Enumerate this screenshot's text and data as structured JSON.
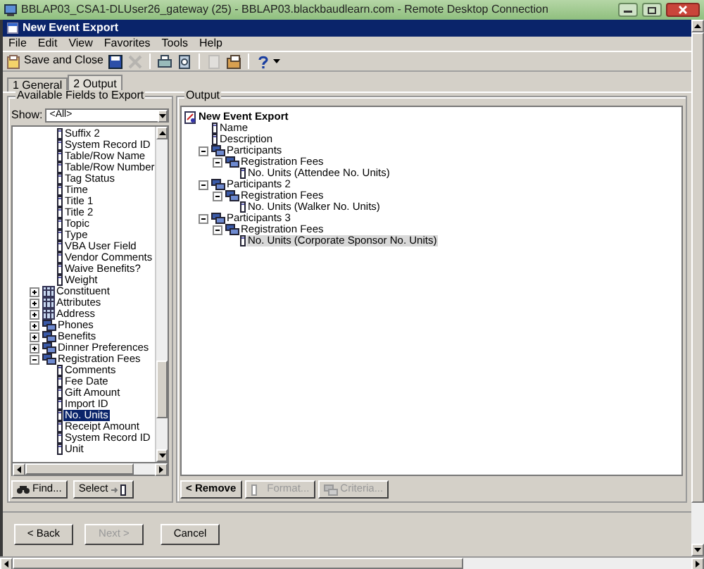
{
  "rdp_window": {
    "title": "BBLAP03_CSA1-DLUser26_gateway (25) - BBLAP03.blackbaudlearn.com - Remote Desktop Connection"
  },
  "app_window": {
    "title": "New Event Export"
  },
  "menu": [
    "File",
    "Edit",
    "View",
    "Favorites",
    "Tools",
    "Help"
  ],
  "toolbar": [
    {
      "kind": "save-close",
      "label": "Save and Close",
      "disabled": false
    },
    {
      "kind": "save",
      "disabled": false
    },
    {
      "kind": "delete",
      "disabled": true
    },
    {
      "kind": "separator"
    },
    {
      "kind": "print",
      "disabled": false
    },
    {
      "kind": "preview",
      "disabled": false
    },
    {
      "kind": "separator"
    },
    {
      "kind": "page",
      "disabled": true
    },
    {
      "kind": "properties",
      "disabled": false
    },
    {
      "kind": "separator"
    },
    {
      "kind": "help",
      "disabled": false
    }
  ],
  "tabs": [
    {
      "label": "1 General",
      "selected": false
    },
    {
      "label": "2 Output",
      "selected": true
    }
  ],
  "fields_panel": {
    "title": "Available Fields to Export",
    "show_label": "Show:",
    "show_value": "<All>",
    "continued_items": [
      {
        "label": "Suffix 2",
        "kind": "field",
        "selected": false
      },
      {
        "label": "System Record ID",
        "kind": "field",
        "selected": false
      },
      {
        "label": "Table/Row Name",
        "kind": "field",
        "selected": false
      },
      {
        "label": "Table/Row Number",
        "kind": "field",
        "selected": false
      },
      {
        "label": "Tag Status",
        "kind": "field",
        "selected": false
      },
      {
        "label": "Time",
        "kind": "field",
        "selected": false
      },
      {
        "label": "Title 1",
        "kind": "field",
        "selected": false
      },
      {
        "label": "Title 2",
        "kind": "field",
        "selected": false
      },
      {
        "label": "Topic",
        "kind": "field",
        "selected": false
      },
      {
        "label": "Type",
        "kind": "field",
        "selected": false
      },
      {
        "label": "VBA User Field",
        "kind": "field",
        "selected": false
      },
      {
        "label": "Vendor Comments",
        "kind": "field",
        "selected": false
      },
      {
        "label": "Waive Benefits?",
        "kind": "field",
        "selected": false
      },
      {
        "label": "Weight",
        "kind": "field",
        "selected": false
      }
    ],
    "items": [
      {
        "label": "Constituent",
        "kind": "table",
        "expanded": false,
        "selected": false
      },
      {
        "label": "Attributes",
        "kind": "table",
        "expanded": false,
        "selected": false
      },
      {
        "label": "Address",
        "kind": "table",
        "expanded": false,
        "selected": false
      },
      {
        "label": "Phones",
        "kind": "group",
        "expanded": false,
        "selected": false
      },
      {
        "label": "Benefits",
        "kind": "group",
        "expanded": false,
        "selected": false
      },
      {
        "label": "Dinner Preferences",
        "kind": "group",
        "expanded": false,
        "selected": false
      },
      {
        "label": "Registration Fees",
        "kind": "group",
        "expanded": true,
        "selected": false,
        "children": [
          {
            "label": "Comments",
            "kind": "field",
            "selected": false
          },
          {
            "label": "Fee Date",
            "kind": "field",
            "selected": false
          },
          {
            "label": "Gift Amount",
            "kind": "field",
            "selected": false
          },
          {
            "label": "Import ID",
            "kind": "field",
            "selected": false
          },
          {
            "label": "No. Units",
            "kind": "field",
            "selected": true
          },
          {
            "label": "Receipt Amount",
            "kind": "field",
            "selected": false
          },
          {
            "label": "System Record ID",
            "kind": "field",
            "selected": false
          },
          {
            "label": "Unit",
            "kind": "field",
            "selected": false
          }
        ]
      }
    ],
    "buttons": [
      {
        "kind": "find",
        "label": "Find...",
        "disabled": false
      },
      {
        "kind": "select",
        "label": "Select",
        "disabled": false
      }
    ]
  },
  "output_panel": {
    "title": "Output",
    "tree": [
      {
        "label": "New Event Export",
        "kind": "root",
        "selected": false,
        "children": [
          {
            "label": "Name",
            "kind": "field",
            "selected": false
          },
          {
            "label": "Description",
            "kind": "field",
            "selected": false
          },
          {
            "label": "Participants",
            "kind": "group",
            "expanded": true,
            "selected": false,
            "children": [
              {
                "label": "Registration Fees",
                "kind": "group",
                "expanded": true,
                "selected": false,
                "children": [
                  {
                    "label": "No. Units (Attendee No. Units)",
                    "kind": "field",
                    "selected": false
                  }
                ]
              }
            ]
          },
          {
            "label": "Participants 2",
            "kind": "group",
            "expanded": true,
            "selected": false,
            "children": [
              {
                "label": "Registration Fees",
                "kind": "group",
                "expanded": true,
                "selected": false,
                "children": [
                  {
                    "label": "No. Units (Walker No. Units)",
                    "kind": "field",
                    "selected": false
                  }
                ]
              }
            ]
          },
          {
            "label": "Participants 3",
            "kind": "group",
            "expanded": true,
            "selected": false,
            "children": [
              {
                "label": "Registration Fees",
                "kind": "group",
                "expanded": true,
                "selected": false,
                "children": [
                  {
                    "label": "No. Units (Corporate Sponsor No. Units)",
                    "kind": "field",
                    "selected": true
                  }
                ]
              }
            ]
          }
        ]
      }
    ],
    "buttons": [
      {
        "kind": "remove",
        "label": "< Remove",
        "disabled": false
      },
      {
        "kind": "format",
        "label": "Format...",
        "disabled": true
      },
      {
        "kind": "criteria",
        "label": "Criteria...",
        "disabled": true
      }
    ]
  },
  "wizard_buttons": [
    {
      "label": "< Back",
      "disabled": false
    },
    {
      "label": "Next >",
      "disabled": true
    },
    {
      "label": "Cancel",
      "disabled": false
    }
  ]
}
